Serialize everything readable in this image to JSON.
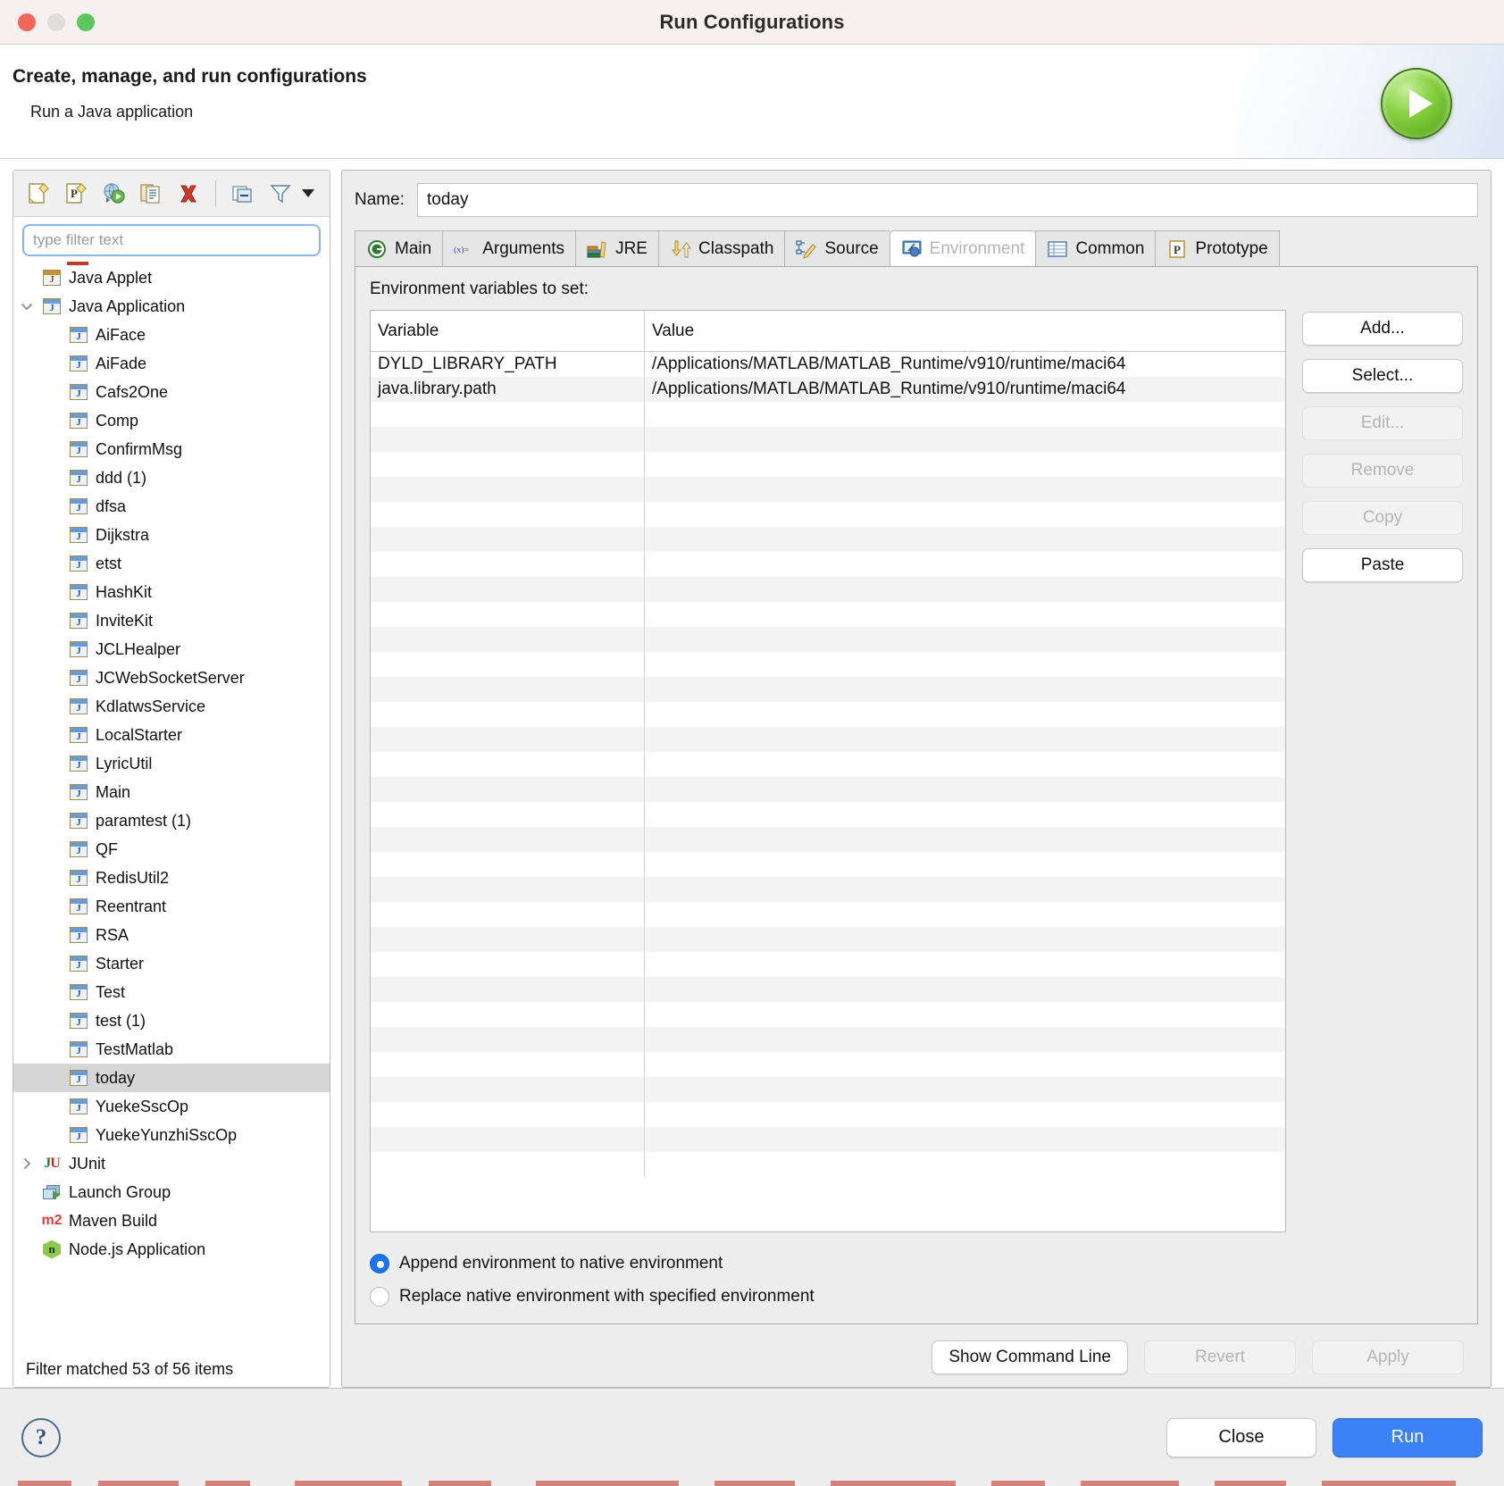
{
  "window": {
    "title": "Run Configurations",
    "traffic_lights": [
      "close",
      "minimize",
      "maximize"
    ]
  },
  "header": {
    "title": "Create, manage, and run configurations",
    "subtitle": "Run a Java application",
    "badge_icon": "run-play-icon"
  },
  "left_panel": {
    "toolbar": [
      {
        "name": "new-configuration-icon",
        "tooltip": "New launch configuration"
      },
      {
        "name": "new-prototype-icon",
        "tooltip": "New prototype"
      },
      {
        "name": "export-configuration-icon",
        "tooltip": "Export"
      },
      {
        "name": "duplicate-configuration-icon",
        "tooltip": "Duplicate"
      },
      {
        "name": "delete-configuration-icon",
        "tooltip": "Delete"
      },
      {
        "name": "collapse-all-icon",
        "tooltip": "Collapse All"
      },
      {
        "name": "filter-icon",
        "tooltip": "Filter"
      },
      {
        "name": "chevron-down-icon",
        "tooltip": "Filter menu"
      }
    ],
    "filter": {
      "placeholder": "type filter text",
      "value": ""
    },
    "tree": [
      {
        "label": "Java Applet",
        "icon": "java-applet-icon",
        "indent": 1,
        "twisty": "none",
        "selected": false
      },
      {
        "label": "Java Application",
        "icon": "java-application-icon",
        "indent": 1,
        "twisty": "expanded",
        "selected": false
      },
      {
        "label": "AiFace",
        "icon": "java-config-icon",
        "indent": 2,
        "twisty": "none",
        "selected": false
      },
      {
        "label": "AiFade",
        "icon": "java-config-icon",
        "indent": 2,
        "twisty": "none",
        "selected": false
      },
      {
        "label": "Cafs2One",
        "icon": "java-config-icon",
        "indent": 2,
        "twisty": "none",
        "selected": false
      },
      {
        "label": "Comp",
        "icon": "java-config-icon",
        "indent": 2,
        "twisty": "none",
        "selected": false
      },
      {
        "label": "ConfirmMsg",
        "icon": "java-config-icon",
        "indent": 2,
        "twisty": "none",
        "selected": false
      },
      {
        "label": "ddd (1)",
        "icon": "java-config-icon",
        "indent": 2,
        "twisty": "none",
        "selected": false
      },
      {
        "label": "dfsa",
        "icon": "java-config-icon",
        "indent": 2,
        "twisty": "none",
        "selected": false
      },
      {
        "label": "Dijkstra",
        "icon": "java-config-icon",
        "indent": 2,
        "twisty": "none",
        "selected": false
      },
      {
        "label": "etst",
        "icon": "java-config-icon",
        "indent": 2,
        "twisty": "none",
        "selected": false
      },
      {
        "label": "HashKit",
        "icon": "java-config-icon",
        "indent": 2,
        "twisty": "none",
        "selected": false
      },
      {
        "label": "InviteKit",
        "icon": "java-config-icon",
        "indent": 2,
        "twisty": "none",
        "selected": false
      },
      {
        "label": "JCLHealper",
        "icon": "java-config-icon",
        "indent": 2,
        "twisty": "none",
        "selected": false
      },
      {
        "label": "JCWebSocketServer",
        "icon": "java-config-icon",
        "indent": 2,
        "twisty": "none",
        "selected": false
      },
      {
        "label": "KdlatwsService",
        "icon": "java-config-icon",
        "indent": 2,
        "twisty": "none",
        "selected": false
      },
      {
        "label": "LocalStarter",
        "icon": "java-config-icon",
        "indent": 2,
        "twisty": "none",
        "selected": false
      },
      {
        "label": "LyricUtil",
        "icon": "java-config-icon",
        "indent": 2,
        "twisty": "none",
        "selected": false
      },
      {
        "label": "Main",
        "icon": "java-config-icon",
        "indent": 2,
        "twisty": "none",
        "selected": false
      },
      {
        "label": "paramtest (1)",
        "icon": "java-config-icon",
        "indent": 2,
        "twisty": "none",
        "selected": false
      },
      {
        "label": "QF",
        "icon": "java-config-icon",
        "indent": 2,
        "twisty": "none",
        "selected": false
      },
      {
        "label": "RedisUtil2",
        "icon": "java-config-icon",
        "indent": 2,
        "twisty": "none",
        "selected": false
      },
      {
        "label": "Reentrant",
        "icon": "java-config-icon",
        "indent": 2,
        "twisty": "none",
        "selected": false
      },
      {
        "label": "RSA",
        "icon": "java-config-icon",
        "indent": 2,
        "twisty": "none",
        "selected": false
      },
      {
        "label": "Starter",
        "icon": "java-config-icon",
        "indent": 2,
        "twisty": "none",
        "selected": false
      },
      {
        "label": "Test",
        "icon": "java-config-icon",
        "indent": 2,
        "twisty": "none",
        "selected": false
      },
      {
        "label": "test (1)",
        "icon": "java-config-icon",
        "indent": 2,
        "twisty": "none",
        "selected": false
      },
      {
        "label": "TestMatlab",
        "icon": "java-config-icon",
        "indent": 2,
        "twisty": "none",
        "selected": false
      },
      {
        "label": "today",
        "icon": "java-config-icon",
        "indent": 2,
        "twisty": "none",
        "selected": true
      },
      {
        "label": "YuekeSscOp",
        "icon": "java-config-icon",
        "indent": 2,
        "twisty": "none",
        "selected": false
      },
      {
        "label": "YuekeYunzhiSscOp",
        "icon": "java-config-icon",
        "indent": 2,
        "twisty": "none",
        "selected": false
      },
      {
        "label": "JUnit",
        "icon": "junit-icon",
        "indent": 1,
        "twisty": "collapsed",
        "selected": false
      },
      {
        "label": "Launch Group",
        "icon": "launch-group-icon",
        "indent": 1,
        "twisty": "none",
        "selected": false
      },
      {
        "label": "Maven Build",
        "icon": "maven-icon",
        "indent": 1,
        "twisty": "none",
        "selected": false
      },
      {
        "label": "Node.js Application",
        "icon": "nodejs-icon",
        "indent": 1,
        "twisty": "none",
        "selected": false
      }
    ],
    "status": "Filter matched 53 of 56 items"
  },
  "right_panel": {
    "name_label": "Name:",
    "name_value": "today",
    "tabs": [
      {
        "label": "Main",
        "icon": "main-class-icon",
        "active": false
      },
      {
        "label": "Arguments",
        "icon": "arguments-icon",
        "active": false
      },
      {
        "label": "JRE",
        "icon": "jre-books-icon",
        "active": false
      },
      {
        "label": "Classpath",
        "icon": "classpath-arrows-icon",
        "active": false
      },
      {
        "label": "Source",
        "icon": "source-pencil-icon",
        "active": false
      },
      {
        "label": "Environment",
        "icon": "environment-icon",
        "active": true
      },
      {
        "label": "Common",
        "icon": "common-table-icon",
        "active": false
      },
      {
        "label": "Prototype",
        "icon": "prototype-icon",
        "active": false
      }
    ],
    "environment": {
      "section_label": "Environment variables to set:",
      "columns": [
        "Variable",
        "Value"
      ],
      "rows": [
        {
          "variable": "DYLD_LIBRARY_PATH",
          "value": "/Applications/MATLAB/MATLAB_Runtime/v910/runtime/maci64"
        },
        {
          "variable": "java.library.path",
          "value": "/Applications/MATLAB/MATLAB_Runtime/v910/runtime/maci64"
        }
      ],
      "buttons": [
        {
          "label": "Add...",
          "disabled": false
        },
        {
          "label": "Select...",
          "disabled": false
        },
        {
          "label": "Edit...",
          "disabled": true
        },
        {
          "label": "Remove",
          "disabled": true
        },
        {
          "label": "Copy",
          "disabled": true
        },
        {
          "label": "Paste",
          "disabled": false
        }
      ],
      "radios": [
        {
          "label": "Append environment to native environment",
          "selected": true
        },
        {
          "label": "Replace native environment with specified environment",
          "selected": false
        }
      ]
    },
    "actions": [
      {
        "label": "Show Command Line",
        "disabled": false
      },
      {
        "label": "Revert",
        "disabled": true
      },
      {
        "label": "Apply",
        "disabled": true
      }
    ]
  },
  "footer": {
    "help_label": "?",
    "buttons": [
      {
        "label": "Close",
        "kind": "secondary"
      },
      {
        "label": "Run",
        "kind": "primary"
      }
    ]
  },
  "colors": {
    "accent": "#3b82f6",
    "radio_on": "#1a73ef",
    "selection": "#d6d6d6",
    "panel_bg": "#ededed",
    "delete_red": "#d03a2c",
    "maven_red": "#e53935",
    "node_green": "#8cc84b"
  }
}
